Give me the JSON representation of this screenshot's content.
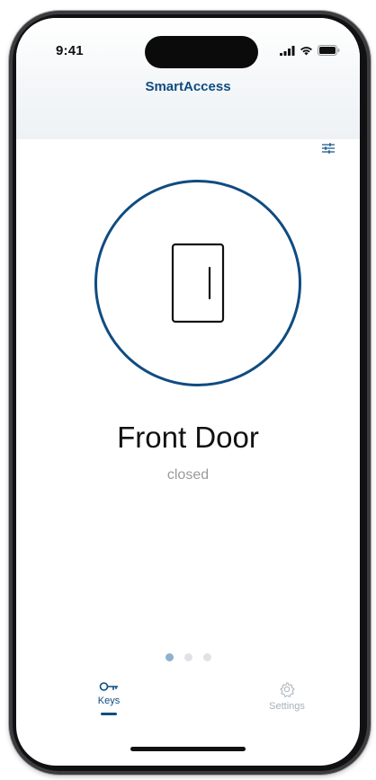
{
  "status_bar": {
    "time": "9:41"
  },
  "header": {
    "app_title": "SmartAccess",
    "filter_icon": "sliders-icon"
  },
  "lock": {
    "icon": "door-icon",
    "name": "Front Door",
    "state": "closed"
  },
  "pager": {
    "count": 3,
    "active_index": 0
  },
  "tabs": [
    {
      "label": "Keys",
      "icon": "key-icon",
      "active": true
    },
    {
      "label": "Settings",
      "icon": "gear-icon",
      "active": false
    }
  ],
  "colors": {
    "brand": "#0f4c81",
    "muted_text": "#9a9a9a",
    "inactive_tab": "#a6b0ba",
    "active_dot": "#8fb1cc",
    "inactive_dot": "#dfe3e7"
  }
}
